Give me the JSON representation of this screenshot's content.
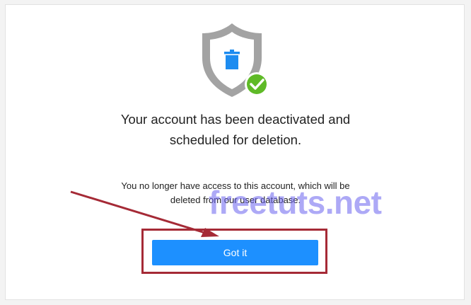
{
  "dialog": {
    "icon": "shield-trash-check-icon",
    "title_line1": "Your account has been deactivated and",
    "title_line2": "scheduled for deletion.",
    "message_line1": "You no longer have access to this account, which will be",
    "message_line2": "deleted from our user database.",
    "button_label": "Got it"
  },
  "overlay": {
    "watermark": "freetuts.net"
  },
  "colors": {
    "button": "#1d90ff",
    "shield": "#a3a3a3",
    "trash": "#1d8cf0",
    "check": "#5fba27",
    "annotation": "#a52a36",
    "watermark": "#6b63f0"
  }
}
